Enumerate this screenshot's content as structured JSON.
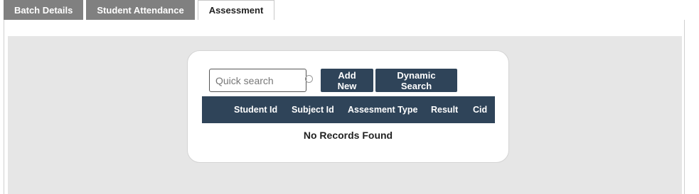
{
  "tabs": [
    {
      "label": "Batch Details",
      "active": false
    },
    {
      "label": "Student Attendance",
      "active": false
    },
    {
      "label": "Assessment",
      "active": true
    }
  ],
  "toolbar": {
    "search_placeholder": "Quick search",
    "search_value": "",
    "add_new_label": "Add New",
    "dynamic_search_label": "Dynamic Search"
  },
  "table": {
    "columns": [
      "Student Id",
      "Subject Id",
      "Assesment Type",
      "Result",
      "Cid"
    ],
    "rows": [],
    "empty_message": "No Records Found"
  },
  "colors": {
    "tab_inactive": "#808080",
    "button_bg": "#2f4459",
    "header_bg": "#2f4459",
    "panel_bg": "#e6e6e6"
  }
}
